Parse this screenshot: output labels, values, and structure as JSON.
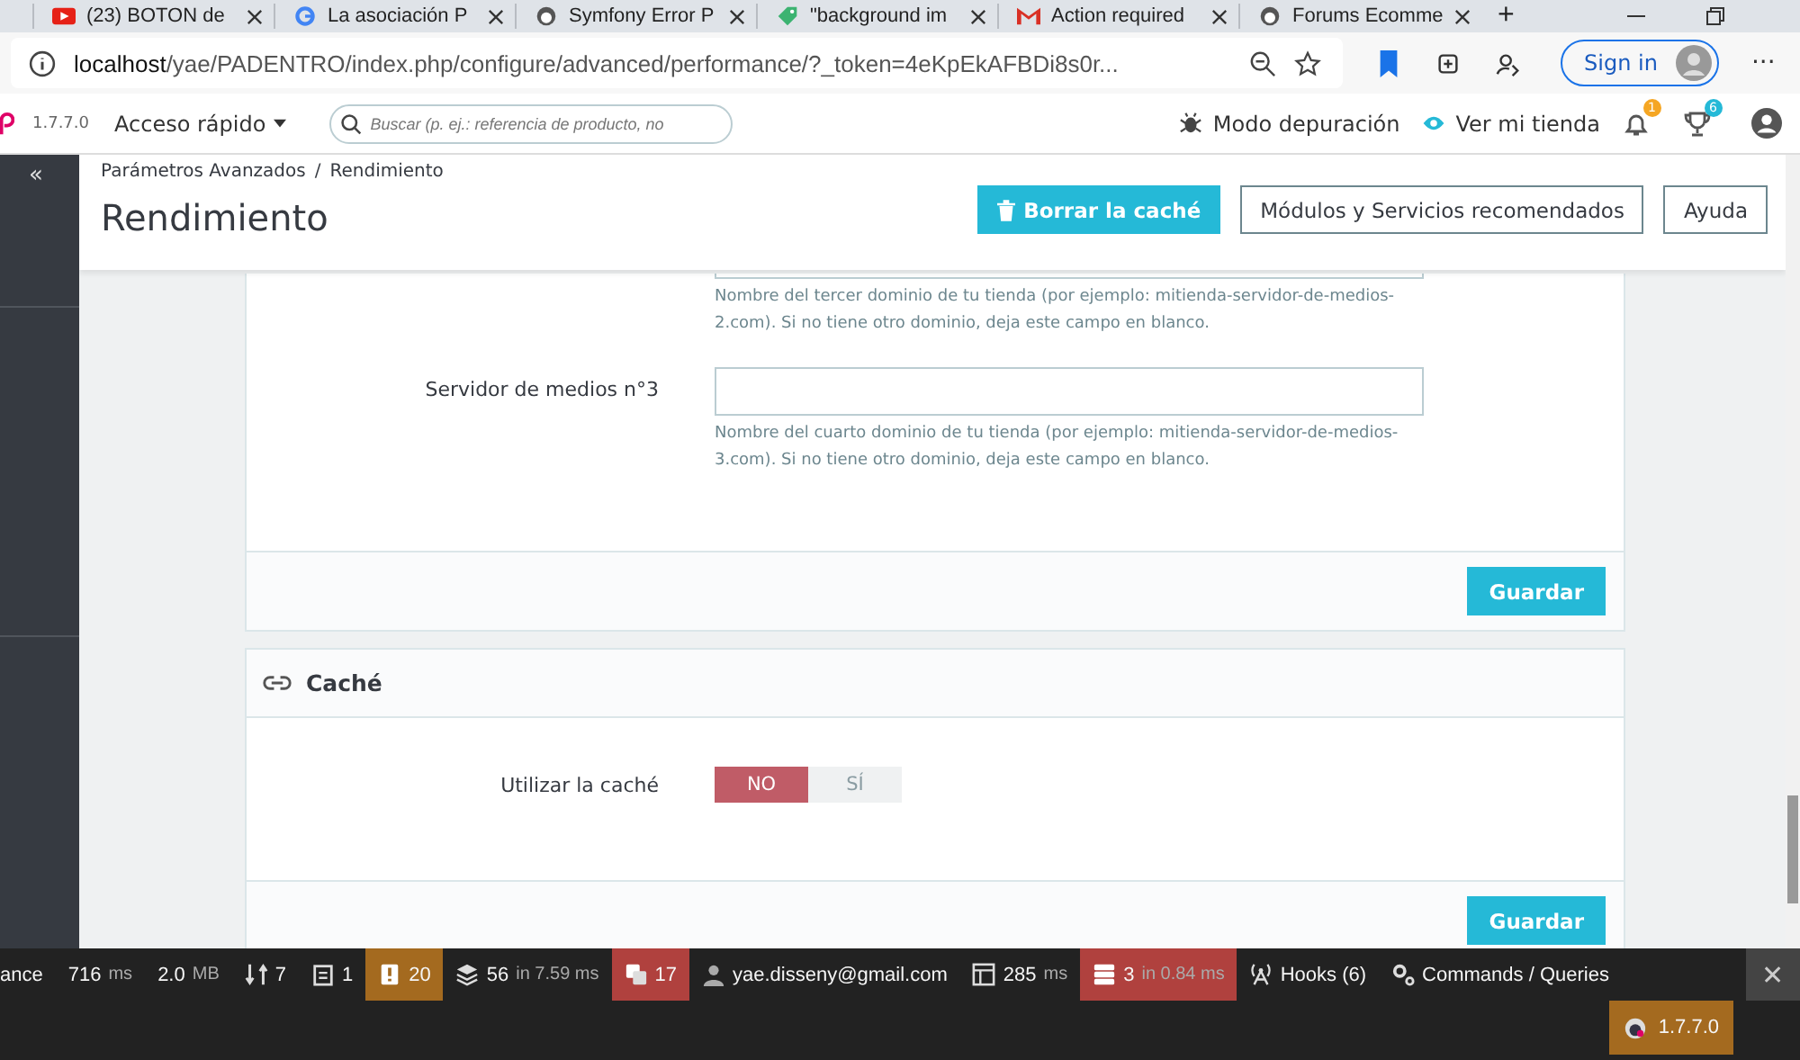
{
  "browser": {
    "tabs": [
      {
        "title": "(23) BOTON de"
      },
      {
        "title": "La asociación P"
      },
      {
        "title": "Symfony Error P"
      },
      {
        "title": "\"background im"
      },
      {
        "title": "Action required"
      },
      {
        "title": "Forums Ecomme"
      }
    ],
    "new_tab": "+",
    "address": {
      "host": "localhost",
      "path": "/yae/PADENTRO/index.php/configure/advanced/performance/?_token=4eKpEkAFBDi8s0r..."
    },
    "sign_in": "Sign in",
    "more": "···"
  },
  "topbar": {
    "version": "1.7.7.0",
    "quick_access": "Acceso rápido",
    "search": {
      "placeholder": "Buscar (p. ej.: referencia de producto, no"
    },
    "debug_mode": "Modo depuración",
    "view_store": "Ver mi tienda",
    "notifications": "1",
    "trophies": "6"
  },
  "sidebar": {
    "collapse": "«"
  },
  "header": {
    "breadcrumb": [
      "Parámetros Avanzados",
      "Rendimiento"
    ],
    "breadcrumb_separator": "/",
    "title": "Rendimiento",
    "buttons": [
      {
        "label": "Borrar la caché",
        "kind": "primary"
      },
      {
        "label": "Módulos y Servicios recomendados",
        "kind": "outline"
      },
      {
        "label": "Ayuda",
        "kind": "outline"
      }
    ]
  },
  "media_card": {
    "fields": [
      {
        "help": "Nombre del tercer dominio de tu tienda (por ejemplo: mitienda-servidor-de-medios-2.com). Si no tiene otro dominio, deja este campo en blanco."
      },
      {
        "label": "Servidor de medios n°3",
        "help": "Nombre del cuarto dominio de tu tienda (por ejemplo: mitienda-servidor-de-medios-3.com). Si no tiene otro dominio, deja este campo en blanco."
      }
    ],
    "save": "Guardar"
  },
  "cache_card": {
    "title": "Caché",
    "field": {
      "label": "Utilizar la caché",
      "options": [
        {
          "label": "NO",
          "selected": true
        },
        {
          "label": "SÍ",
          "selected": false
        }
      ]
    },
    "save": "Guardar"
  },
  "debug_toolbar": {
    "items": [
      {
        "value": "ance",
        "color": "#222222"
      },
      {
        "value": "716",
        "unit": "ms",
        "color": "#222222"
      },
      {
        "value": "2.0",
        "unit": "MB",
        "color": "#222222"
      },
      {
        "value": "7",
        "color": "#222222"
      },
      {
        "value": "1",
        "color": "#222222"
      },
      {
        "value": "20",
        "color": "#a46a1f"
      },
      {
        "value": "56",
        "unit": "in 7.59 ms",
        "color": "#222222"
      },
      {
        "value": "17",
        "color": "#b0413e"
      },
      {
        "value": "yae.disseny@gmail.com",
        "color": "#222222"
      },
      {
        "value": "285",
        "unit": "ms",
        "color": "#222222"
      },
      {
        "value": "3",
        "unit": "in 0.84 ms",
        "color": "#b0413e"
      },
      {
        "value": "Hooks (6)",
        "color": "#222222"
      },
      {
        "value": "Commands / Queries",
        "color": "#222222"
      }
    ],
    "close": "✕",
    "version": "1.7.7.0"
  }
}
